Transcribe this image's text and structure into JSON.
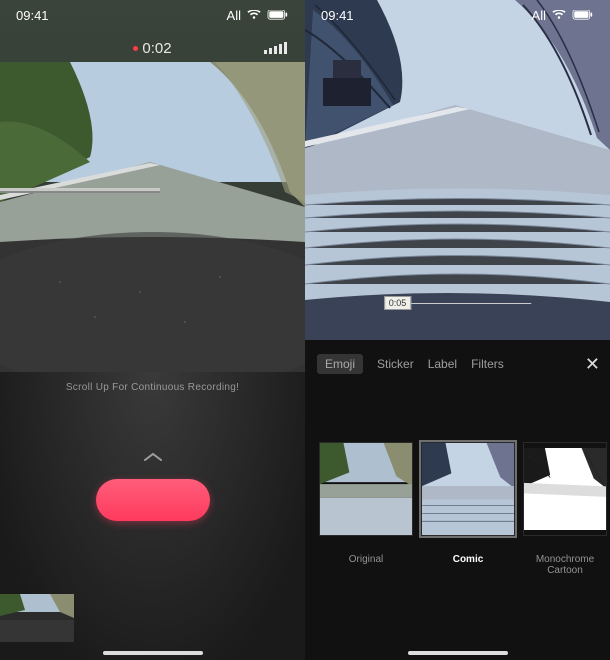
{
  "status": {
    "time": "09:41",
    "network": "All"
  },
  "left": {
    "rec_time": "0:02",
    "scroll_hint": "Scroll Up For Continuous Recording!"
  },
  "right": {
    "playback_time": "0:05",
    "tabs": [
      "Emoji",
      "Sticker",
      "Label",
      "Filters"
    ],
    "active_tab_index": 0,
    "filters": [
      {
        "name": "Original"
      },
      {
        "name": "Comic"
      },
      {
        "name": "Monochrome Cartoon"
      }
    ],
    "active_filter_index": 1
  }
}
